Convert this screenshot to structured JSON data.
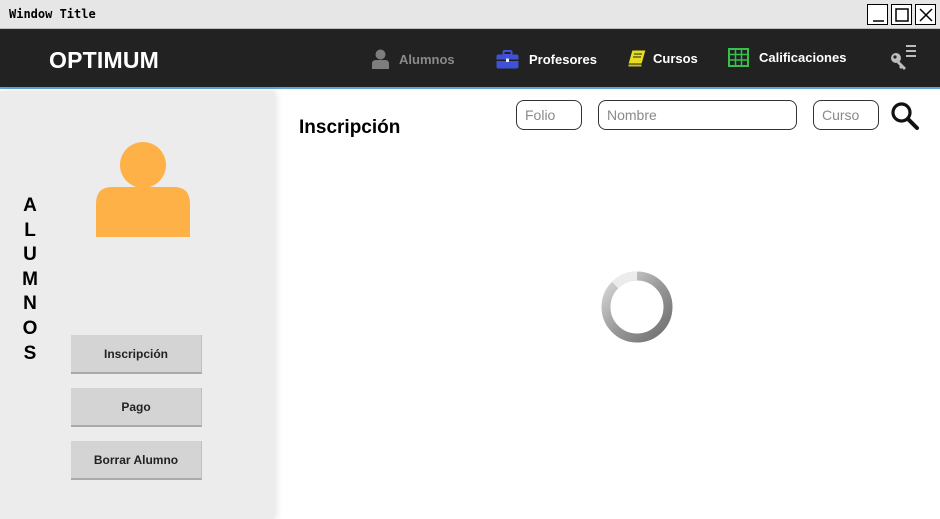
{
  "window": {
    "title": "Window Title"
  },
  "navbar": {
    "brand": "OPTIMUM",
    "items": [
      {
        "label": "Alumnos",
        "icon": "user-icon",
        "color": "#8a8a8a"
      },
      {
        "label": "Profesores",
        "icon": "briefcase-icon",
        "color": "#3f51d6"
      },
      {
        "label": "Cursos",
        "icon": "book-icon",
        "color": "#e5dd1e"
      },
      {
        "label": "Calificaciones",
        "icon": "grid-table-icon",
        "color": "#35c14a"
      }
    ],
    "settings_icon": "key-menu-icon",
    "accent": "#5aa4df"
  },
  "sidebar": {
    "vertical_title": [
      "A",
      "L",
      "U",
      "M",
      "N",
      "O",
      "S"
    ],
    "avatar_color": "#fdb147",
    "buttons": {
      "inscripcion": "Inscripción",
      "pago": "Pago",
      "borrar": "Borrar Alumno"
    }
  },
  "main": {
    "title": "Inscripción",
    "search": {
      "folio_placeholder": "Folio",
      "nombre_placeholder": "Nombre",
      "curso_placeholder": "Curso"
    },
    "loading_icon": "spinner-icon"
  }
}
